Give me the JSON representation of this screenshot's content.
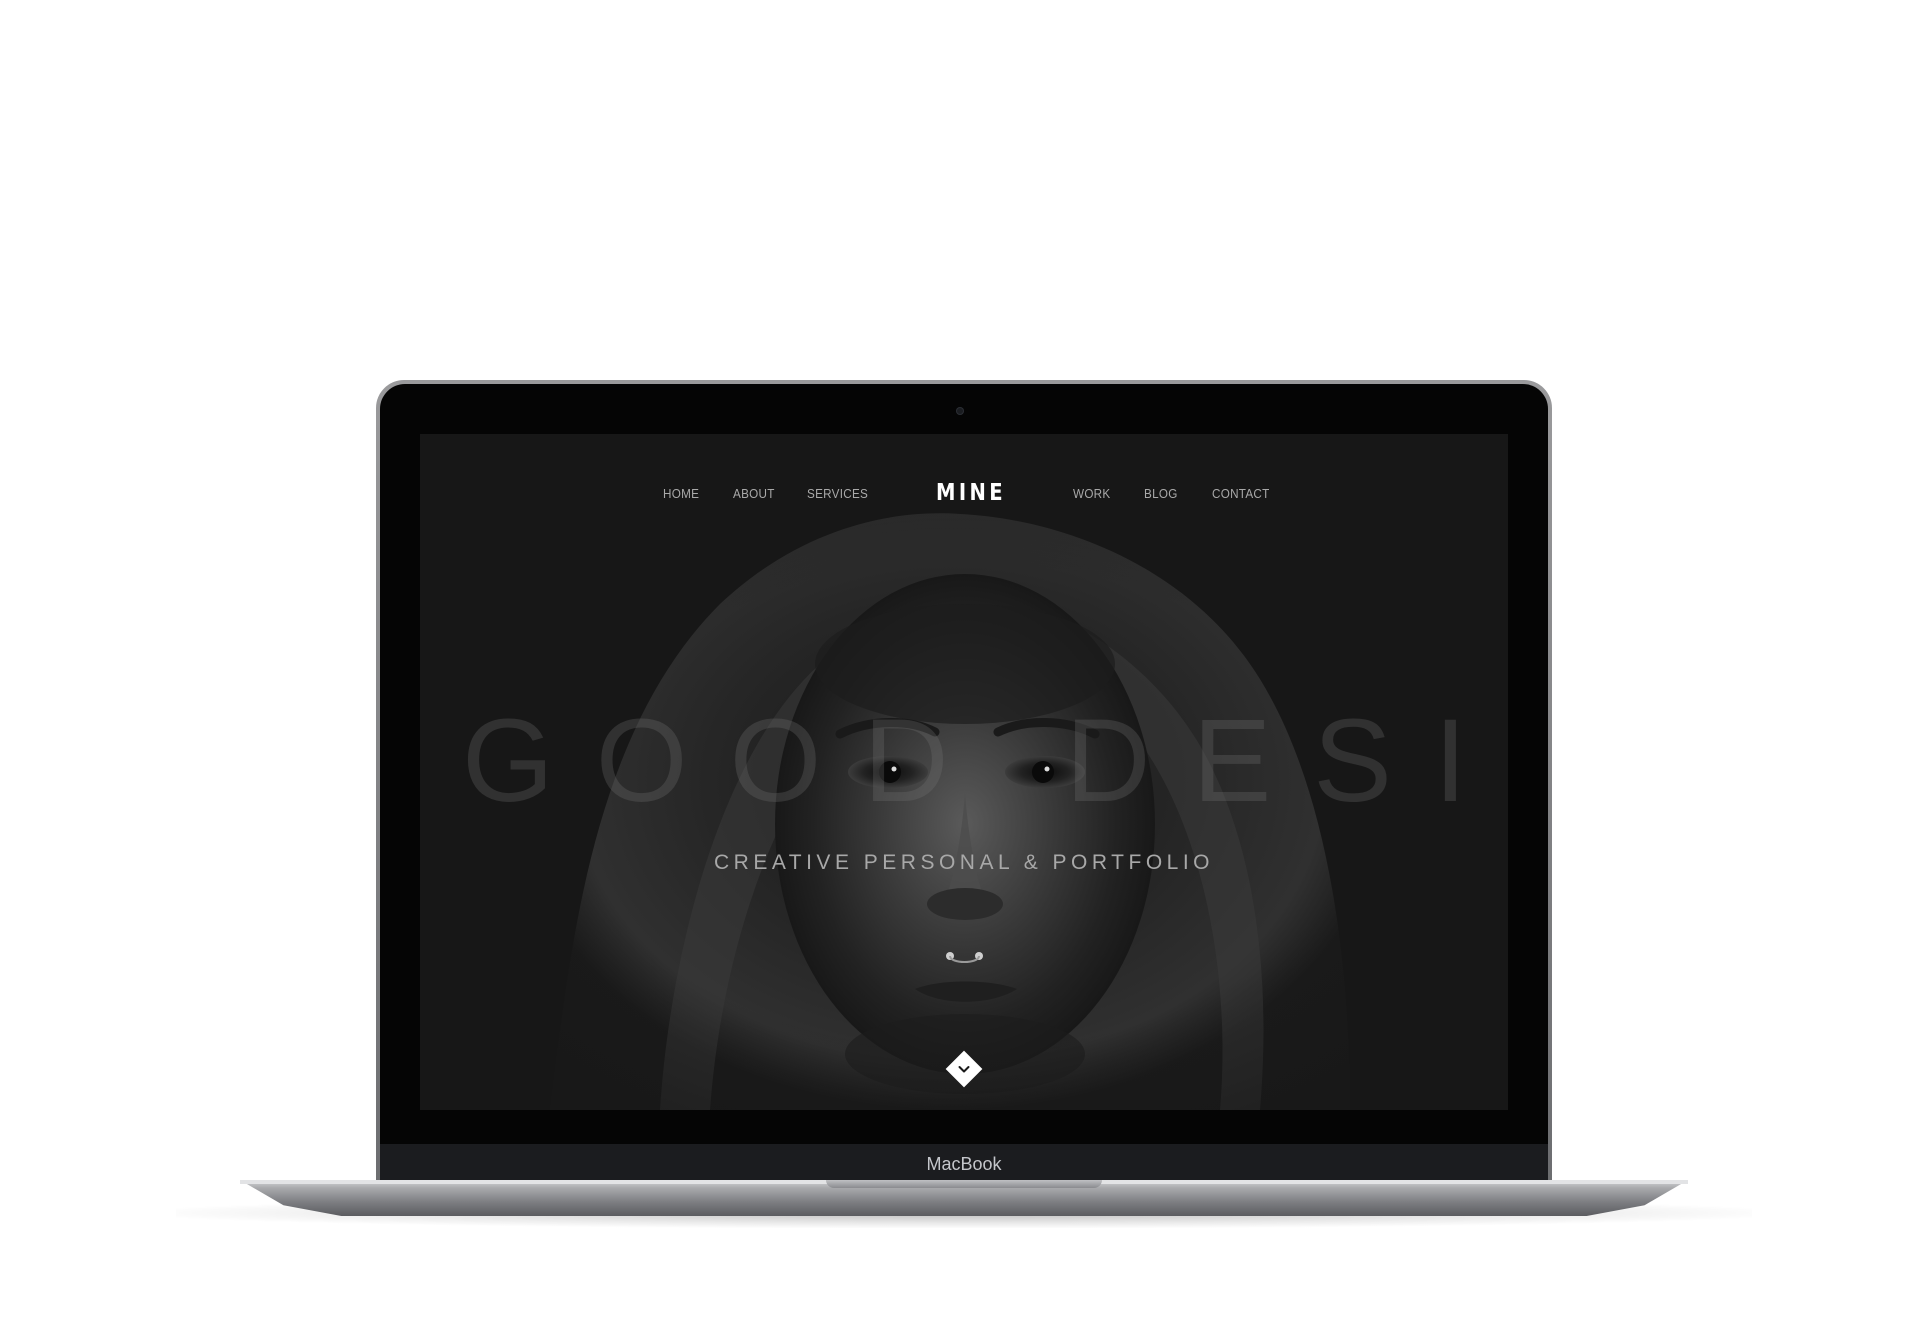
{
  "device": {
    "brand_label": "MacBook",
    "bezel_color": "#050505",
    "body_color": "#8a8b8e"
  },
  "site": {
    "logo": "MINE",
    "nav_left": [
      "HOME",
      "ABOUT",
      "SERVICES"
    ],
    "nav_right": [
      "WORK",
      "BLOG",
      "CONTACT"
    ],
    "hero_title": "GOOD DESIGN",
    "hero_subtitle": "CREATIVE PERSONAL & PORTFOLIO",
    "scroll_icon": "chevron-down-icon",
    "background_color": "#171717",
    "text_color": "#a9a9a9",
    "accent_color": "#ffffff"
  }
}
